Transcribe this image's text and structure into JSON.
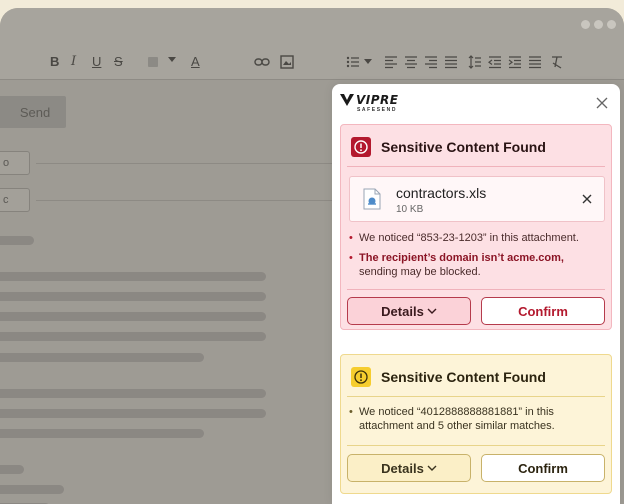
{
  "window": {
    "control_dots": 3
  },
  "toolbar": {
    "bold": "B",
    "italic": "I",
    "underline": "U",
    "strike": "S",
    "font_color": "A"
  },
  "compose": {
    "send_label": "Send",
    "to_label": "o",
    "cc_label": "c"
  },
  "panel": {
    "brand": "VIPRE",
    "brand_sub": "SAFESEND",
    "alerts": [
      {
        "severity": "red",
        "title": "Sensitive Content Found",
        "file": {
          "name": "contractors.xls",
          "size": "10 KB"
        },
        "note1": "We noticed “853-23-1203” in this attachment.",
        "note2_bold": "The recipient’s domain isn’t acme.com,",
        "note2_rest": " sending may be blocked.",
        "details_label": "Details",
        "confirm_label": "Confirm"
      },
      {
        "severity": "yellow",
        "title": "Sensitive Content Found",
        "note1": "We noticed “4012888888881881” in this attachment and 5 other similar matches.",
        "details_label": "Details",
        "confirm_label": "Confirm"
      }
    ]
  },
  "colors": {
    "red_alert_bg": "#fde0e4",
    "red_accent": "#b3192e",
    "yellow_alert_bg": "#fdf4d8",
    "yellow_accent": "#f6cd2e"
  }
}
